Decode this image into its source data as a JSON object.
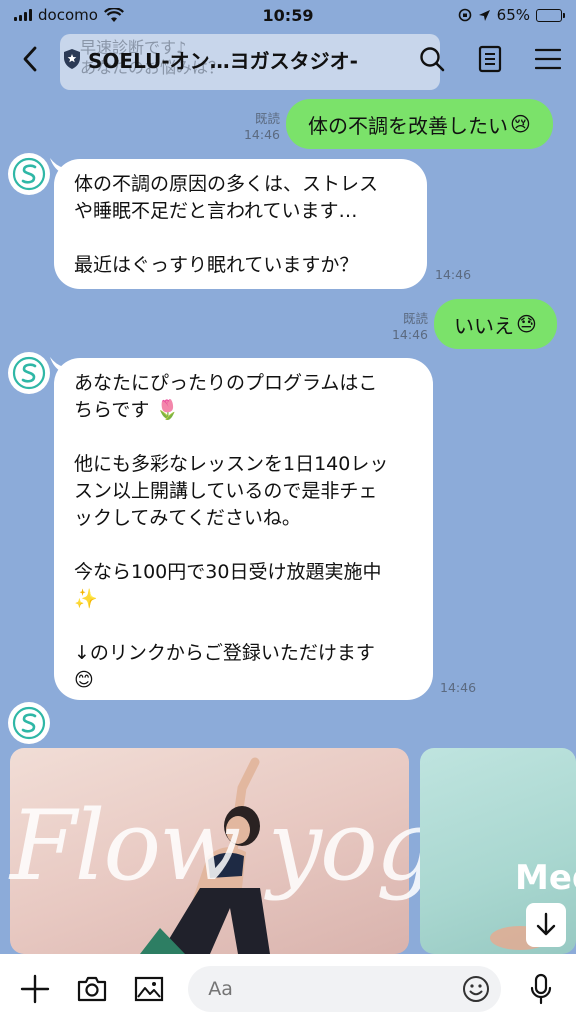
{
  "status_bar": {
    "carrier": "docomo",
    "time": "10:59",
    "battery": "65%",
    "battery_level": 0.65
  },
  "header": {
    "banner_text": "早速診断です♪\nあなたのお悩みは？",
    "title": "SOELU-オン…ヨガスタジオ-",
    "icons": [
      "back-icon",
      "shield-icon",
      "search-icon",
      "notes-icon",
      "menu-icon"
    ]
  },
  "messages": [
    {
      "side": "right",
      "read": "既読",
      "time": "14:46",
      "text": "体の不調を改善したい",
      "emoji": "😢"
    },
    {
      "side": "left",
      "time": "14:46",
      "text": "体の不調の原因の多くは、ストレス\nや睡眠不足だと言われています…\n\n最近はぐっすり眠れていますか？"
    },
    {
      "side": "right",
      "read": "既読",
      "time": "14:46",
      "text": "いいえ",
      "emoji": "😓"
    },
    {
      "side": "left",
      "time": "14:46",
      "text": "あなたにぴったりのプログラムはこ\nちらです 🌷\n\n他にも多彩なレッスンを1日140レッ\nスン以上開講しているので是非チェ\nックしてみてくださいね。\n\n今なら100円で30日受け放題実施中\n✨\n\n↓のリンクからご登録いただけます\n😊"
    }
  ],
  "cards": [
    {
      "overlay_text": "Flow yoga"
    },
    {
      "overlay_text": "Med"
    }
  ],
  "input": {
    "placeholder": "Aa"
  },
  "colors": {
    "background": "#8cabd9",
    "sent_bubble": "#7be26a",
    "received_bubble": "#ffffff",
    "brand": "#2fb7a6"
  }
}
